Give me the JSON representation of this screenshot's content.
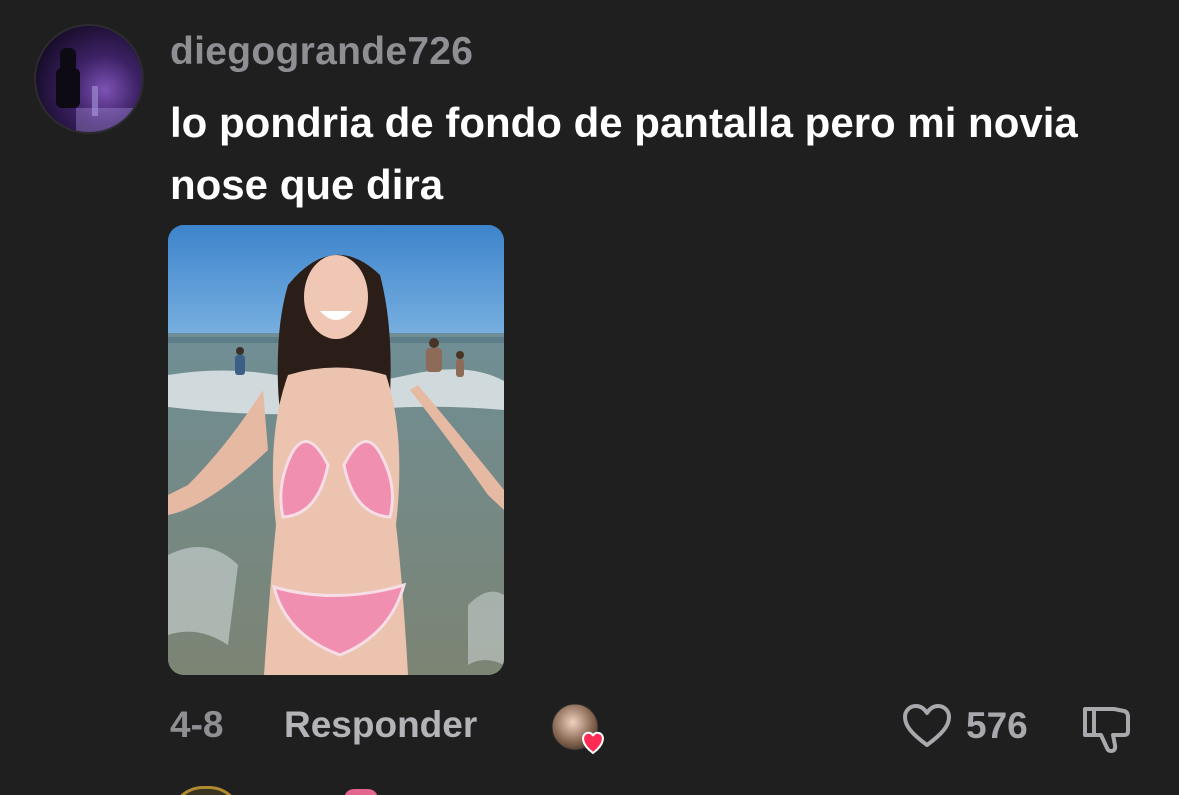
{
  "comment": {
    "username": "diegogrande726",
    "text": "lo pondria de fondo de pantalla pero mi novia nose que dira",
    "avatar_icon": "user-avatar",
    "attached_image": "photo-attachment"
  },
  "footer": {
    "date": "4-8",
    "reply_label": "Responder",
    "creator_liked_icon": "creator-avatar-heart-icon",
    "like_icon": "heart-outline-icon",
    "like_count": "576",
    "dislike_icon": "thumbs-down-icon"
  },
  "colors": {
    "background": "#1f1f20",
    "username": "#8e8e93",
    "comment_text": "#ffffff",
    "heart_badge": "#fe2c55"
  }
}
